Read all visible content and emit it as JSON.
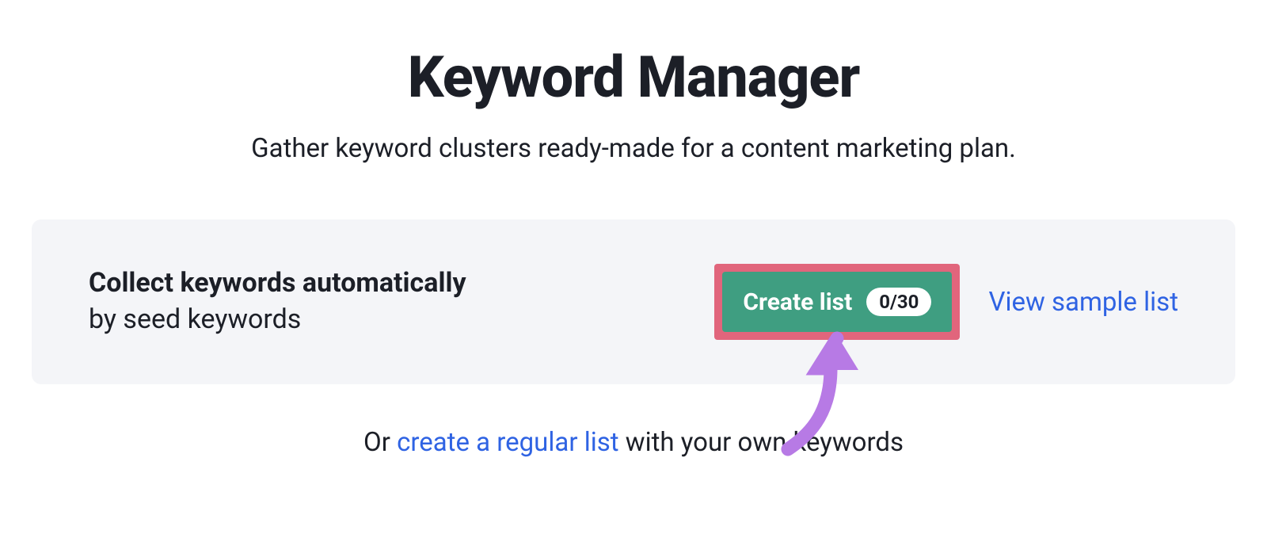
{
  "header": {
    "title": "Keyword Manager",
    "subtitle": "Gather keyword clusters ready-made for a content marketing plan."
  },
  "panel": {
    "heading": "Collect keywords automatically",
    "subtext": "by seed keywords",
    "create_button_label": "Create list",
    "create_button_badge": "0/30",
    "sample_link_label": "View sample list"
  },
  "footer": {
    "prefix": "Or ",
    "link_label": "create a regular list",
    "suffix": " with your own keywords"
  },
  "colors": {
    "accent_green": "#3f9e81",
    "highlight_pink": "#e1657c",
    "link_blue": "#2f63e3",
    "arrow_purple": "#b77ae5",
    "panel_bg": "#f4f5f8",
    "text": "#1c1f27"
  }
}
